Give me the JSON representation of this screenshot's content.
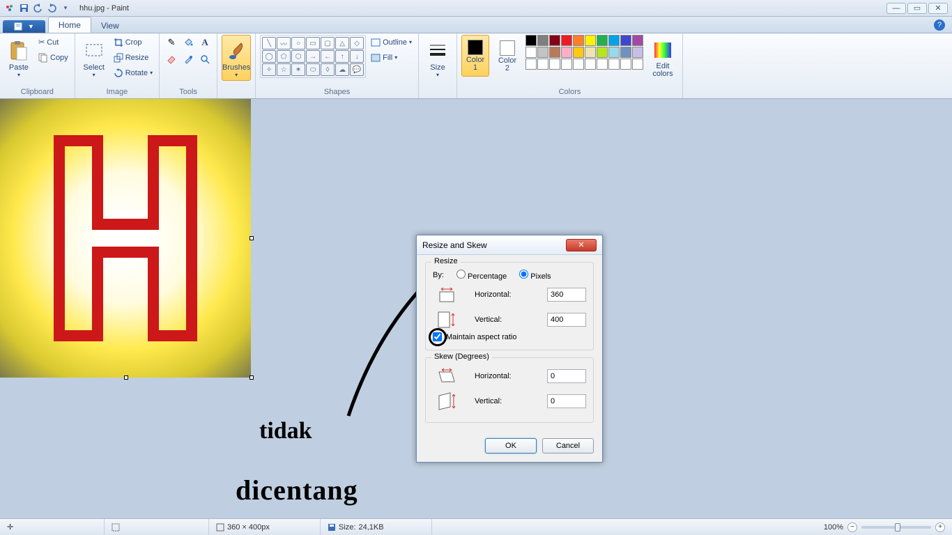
{
  "window": {
    "filename": "hhu.jpg",
    "app": "Paint"
  },
  "tabs": {
    "file": "",
    "home": "Home",
    "view": "View"
  },
  "ribbon": {
    "clipboard": {
      "label": "Clipboard",
      "paste": "Paste",
      "cut": "Cut",
      "copy": "Copy"
    },
    "image": {
      "label": "Image",
      "select": "Select",
      "crop": "Crop",
      "resize": "Resize",
      "rotate": "Rotate"
    },
    "tools": {
      "label": "Tools"
    },
    "brushes": {
      "label": "Brushes"
    },
    "shapes": {
      "label": "Shapes",
      "outline": "Outline",
      "fill": "Fill"
    },
    "size": {
      "label": "Size"
    },
    "colors": {
      "label": "Colors",
      "color1": "Color\n1",
      "color2": "Color\n2",
      "edit": "Edit\ncolors"
    },
    "palette_row1": [
      "#000000",
      "#7f7f7f",
      "#880015",
      "#ed1c24",
      "#ff7f27",
      "#fff200",
      "#22b14c",
      "#00a2e8",
      "#3f48cc",
      "#a349a4"
    ],
    "palette_row2": [
      "#ffffff",
      "#c3c3c3",
      "#b97a57",
      "#ffaec9",
      "#ffc90e",
      "#efe4b0",
      "#b5e61d",
      "#99d9ea",
      "#7092be",
      "#c8bfe7"
    ],
    "palette_row3": [
      "#ffffff",
      "#ffffff",
      "#ffffff",
      "#ffffff",
      "#ffffff",
      "#ffffff",
      "#ffffff",
      "#ffffff",
      "#ffffff",
      "#ffffff"
    ],
    "color1_value": "#000000",
    "color2_value": "#ffffff"
  },
  "dialog": {
    "title": "Resize and Skew",
    "resize": {
      "legend": "Resize",
      "by": "By:",
      "percentage": "Percentage",
      "pixels": "Pixels",
      "by_selected": "Pixels",
      "horizontal": "Horizontal:",
      "vertical": "Vertical:",
      "h_value": "360",
      "v_value": "400",
      "maintain": "Maintain aspect ratio",
      "maintain_checked": true
    },
    "skew": {
      "legend": "Skew (Degrees)",
      "horizontal": "Horizontal:",
      "vertical": "Vertical:",
      "h_value": "0",
      "v_value": "0"
    },
    "ok": "OK",
    "cancel": "Cancel"
  },
  "annotation": {
    "line1": "tidak",
    "line2": "dicentang"
  },
  "status": {
    "dims": "360 × 400px",
    "size_label": "Size:",
    "size_value": "24,1KB",
    "zoom": "100%"
  }
}
